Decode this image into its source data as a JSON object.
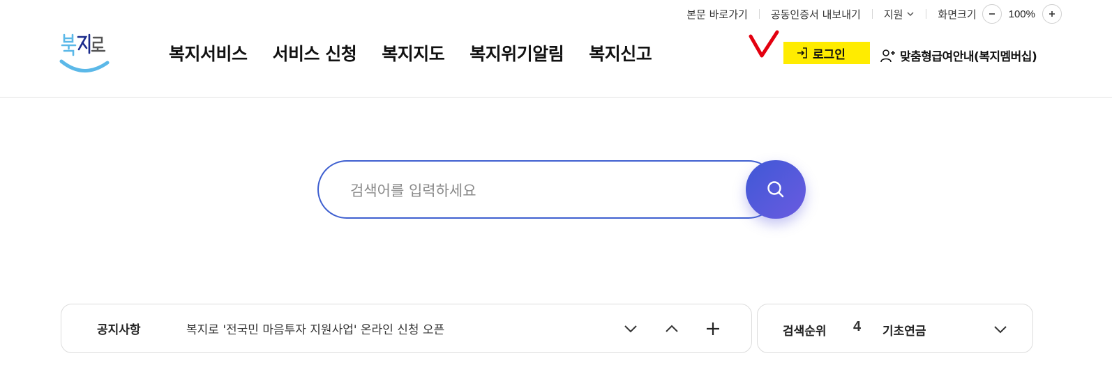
{
  "utility": {
    "skip_to_content": "본문 바로가기",
    "export_certificate": "공동인증서 내보내기",
    "support": "지원",
    "screen_size_label": "화면크기",
    "zoom_value": "100%"
  },
  "logo": {
    "text": "복지로"
  },
  "nav": {
    "items": [
      "복지서비스",
      "서비스 신청",
      "복지지도",
      "복지위기알림",
      "복지신고"
    ]
  },
  "header_actions": {
    "login": "로그인",
    "membership": "맞춤형급여안내(복지멤버십)"
  },
  "search": {
    "placeholder": "검색어를 입력하세요"
  },
  "notice": {
    "title": "공지사항",
    "text": "복지로 '전국민 마음투자 지원사업' 온라인 신청 오픈"
  },
  "ranking": {
    "title": "검색순위",
    "number": "4",
    "term": "기초연금"
  },
  "colors": {
    "accent_blue": "#3e5fd0",
    "search_gradient_end": "#6a5be0",
    "highlight_yellow": "#ffec00",
    "annotation_red": "#e3000f",
    "logo_blue": "#5bb8e8"
  },
  "icons": {
    "login": "login-arrow-icon",
    "membership": "add-user-icon",
    "search": "search-icon",
    "zoom_out": "minus-icon",
    "zoom_in": "plus-icon",
    "notice_next": "chevron-down-icon",
    "notice_prev": "chevron-up-icon",
    "notice_more": "plus-icon",
    "rank_toggle": "chevron-down-icon"
  }
}
